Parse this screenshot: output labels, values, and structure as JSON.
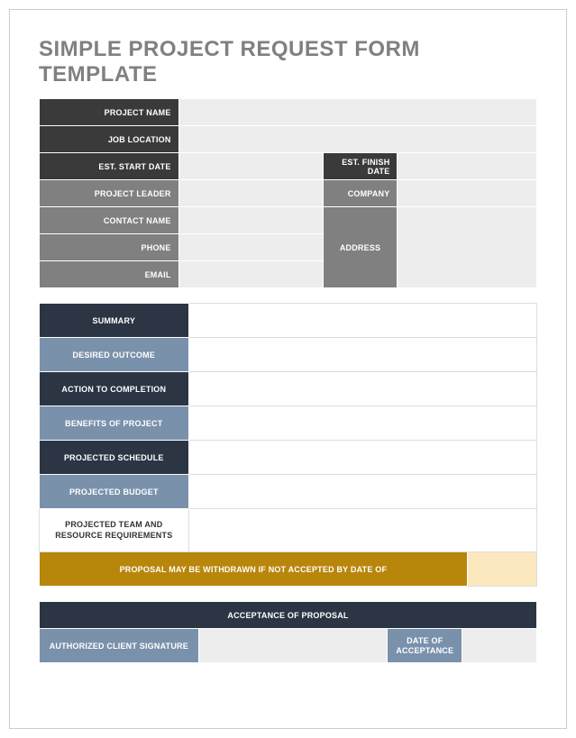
{
  "title": "SIMPLE PROJECT REQUEST FORM TEMPLATE",
  "section1": {
    "project_name": "PROJECT NAME",
    "job_location": "JOB LOCATION",
    "est_start_date": "EST. START DATE",
    "est_finish_date": "EST. FINISH DATE",
    "project_leader": "PROJECT LEADER",
    "company": "COMPANY",
    "contact_name": "CONTACT NAME",
    "phone": "PHONE",
    "email": "EMAIL",
    "address": "ADDRESS"
  },
  "section2": {
    "summary": "SUMMARY",
    "desired_outcome": "DESIRED OUTCOME",
    "action_to_completion": "ACTION TO COMPLETION",
    "benefits_of_project": "BENEFITS OF PROJECT",
    "projected_schedule": "PROJECTED SCHEDULE",
    "projected_budget": "PROJECTED BUDGET",
    "projected_team": "PROJECTED TEAM AND RESOURCE REQUIREMENTS",
    "withdrawal_notice": "PROPOSAL MAY BE WITHDRAWN IF NOT ACCEPTED BY DATE OF"
  },
  "section3": {
    "acceptance_header": "ACCEPTANCE OF PROPOSAL",
    "authorized_signature": "AUTHORIZED CLIENT SIGNATURE",
    "date_of_acceptance": "DATE OF ACCEPTANCE"
  }
}
